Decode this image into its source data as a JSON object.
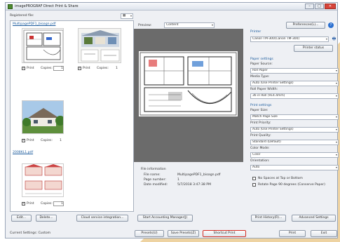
{
  "window": {
    "title": "imagePROGRAF Direct Print & Share",
    "minimize": "–",
    "maximize": "□",
    "close": "✕"
  },
  "registered": {
    "label": "Registered file:",
    "view_icon": "grid-view-icon",
    "file1": "MultipagePDF1_bioagn.pdf",
    "file2": "2008KL1.pdf",
    "print_label": "Print",
    "copies_label": "Copies:",
    "copies_value1": "1",
    "copies_value2": "1",
    "copies_value3": "1",
    "copies_value4": "1"
  },
  "preview": {
    "label": "Preview:",
    "mode": "Content"
  },
  "file_info": {
    "heading": "File information",
    "name_label": "File name:",
    "name_value": "MultipagePDF1_bioagn.pdf",
    "pages_label": "Page number:",
    "pages_value": "1",
    "date_label": "Date modified:",
    "date_value": "5/7/2018 3:47:38 PM"
  },
  "printer": {
    "preferences_button": "Preferences(L)...",
    "section": "Printer",
    "name": "Canon TM-300(Canon TM-300)",
    "printer_status_button": "Printer status"
  },
  "paper_settings": {
    "section": "Paper settings",
    "source_label": "Paper Source:",
    "source_value": "Roll Paper",
    "media_label": "Media Type:",
    "media_value": "Auto (Use Printer Settings)",
    "width_label": "Roll Paper Width:",
    "width_value": "36 in Roll (914.4mm)"
  },
  "print_settings": {
    "section": "Print settings",
    "size_label": "Paper Size:",
    "size_value": "Match Page Size",
    "priority_label": "Print Priority:",
    "priority_value": "Auto (Use Printer Settings)",
    "quality_label": "Print Quality:",
    "quality_value": "Standard (Default)",
    "color_label": "Color Mode:",
    "color_value": "Color",
    "orientation_label": "Orientation:",
    "orientation_value": "Auto",
    "no_spaces_label": "No Spaces at Top or Bottom",
    "rotate_label": "Rotate Page 90 degrees (Conserve Paper)"
  },
  "buttons": {
    "edit": "Edit...",
    "delete": "Delete...",
    "cloud": "Cloud service integration...",
    "accounting": "Start Accounting Manager(J)",
    "print_history": "Print History(R)...",
    "advanced": "Advanced Settings",
    "presets_load": "Presets(U)",
    "presets_save": "Save Presets(Z)",
    "shortcut": "Shortcut Print",
    "print": "Print",
    "exit": "Exit"
  },
  "status": {
    "current_settings": "Current Settings: Custom"
  },
  "colors": {
    "highlight": "#d32b22",
    "section": "#1a5a9c",
    "wedge": "#e9c98f"
  }
}
